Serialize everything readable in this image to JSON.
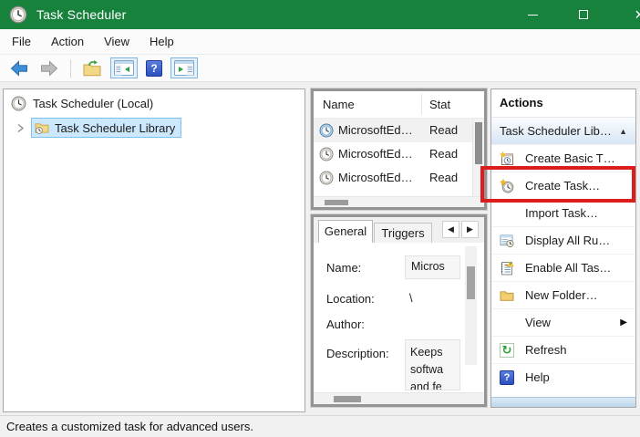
{
  "titlebar": {
    "title": "Task Scheduler"
  },
  "menubar": {
    "items": [
      "File",
      "Action",
      "View",
      "Help"
    ]
  },
  "toolbar": {
    "buttons": [
      "back",
      "forward",
      "export",
      "show-console-tree",
      "help",
      "show-action-pane"
    ]
  },
  "tree": {
    "root_label": "Task Scheduler (Local)",
    "library_label": "Task Scheduler Library"
  },
  "task_list": {
    "columns": {
      "name": "Name",
      "status": "Stat"
    },
    "rows": [
      {
        "name": "MicrosoftEd…",
        "status": "Read"
      },
      {
        "name": "MicrosoftEd…",
        "status": "Read"
      },
      {
        "name": "MicrosoftEd…",
        "status": "Read"
      }
    ]
  },
  "preview": {
    "tabs": {
      "general": "General",
      "triggers": "Triggers"
    },
    "fields": {
      "name_label": "Name:",
      "name_value": "Micros",
      "location_label": "Location:",
      "location_value": "\\",
      "author_label": "Author:",
      "author_value": "",
      "description_label": "Description:",
      "description_value": "Keeps softwa and fe"
    }
  },
  "actions": {
    "panel_title": "Actions",
    "section_title": "Task Scheduler Lib…",
    "items": [
      {
        "label": "Create Basic T…",
        "icon": "create-basic-task-icon"
      },
      {
        "label": "Create Task…",
        "icon": "create-task-icon",
        "highlighted": true
      },
      {
        "label": "Import Task…",
        "icon": ""
      },
      {
        "label": "Display All Ru…",
        "icon": "display-all-running-icon"
      },
      {
        "label": "Enable All Tas…",
        "icon": "enable-all-tasks-icon"
      },
      {
        "label": "New Folder…",
        "icon": "new-folder-icon"
      },
      {
        "label": "View",
        "icon": "",
        "submenu": true
      },
      {
        "label": "Refresh",
        "icon": "refresh-icon"
      },
      {
        "label": "Help",
        "icon": "help-icon"
      }
    ]
  },
  "statusbar": {
    "text": "Creates a customized task for advanced users."
  },
  "glyphs": {
    "collapse_arrow": "▲",
    "submenu_arrow": "▶",
    "tab_scroll_left": "◀",
    "tab_scroll_right": "▶",
    "help_mark": "?",
    "refresh_mark": "↻",
    "close_mark": "×"
  },
  "colors": {
    "titlebar_green": "#17823C",
    "selection_fill": "#CCE8FF",
    "selection_border": "#7EC1EA",
    "annotation_red": "#DD1C1C"
  }
}
